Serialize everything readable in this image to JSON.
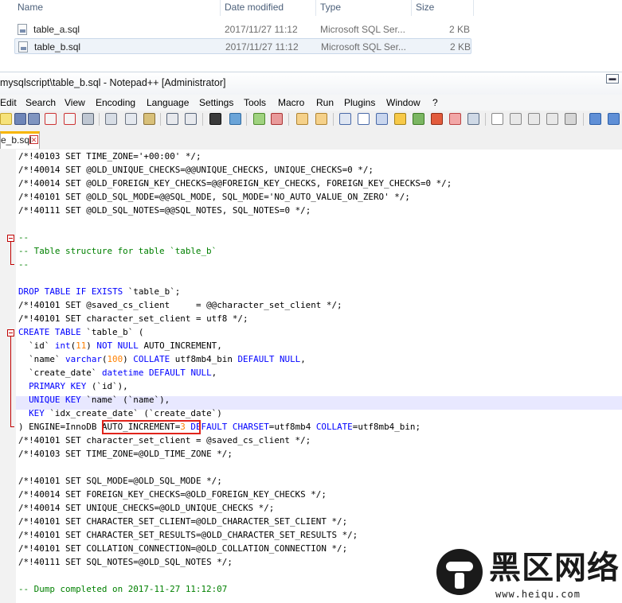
{
  "explorer": {
    "columns": {
      "name": "Name",
      "date": "Date modified",
      "type": "Type",
      "size": "Size"
    },
    "files": [
      {
        "name": "table_a.sql",
        "date": "2017/11/27 11:12",
        "type": "Microsoft SQL Ser...",
        "size": "2 KB"
      },
      {
        "name": "table_b.sql",
        "date": "2017/11/27 11:12",
        "type": "Microsoft SQL Ser...",
        "size": "2 KB"
      }
    ]
  },
  "window": {
    "title": "mysqlscript\\table_b.sql - Notepad++ [Administrator]",
    "menu": [
      "Edit",
      "Search",
      "View",
      "Encoding",
      "Language",
      "Settings",
      "Tools",
      "Macro",
      "Run",
      "Plugins",
      "Window",
      "?"
    ],
    "tab_label": "e_b.sql"
  },
  "code_lines": [
    "/*!40103 SET TIME_ZONE='+00:00' */;",
    "/*!40014 SET @OLD_UNIQUE_CHECKS=@@UNIQUE_CHECKS, UNIQUE_CHECKS=0 */;",
    "/*!40014 SET @OLD_FOREIGN_KEY_CHECKS=@@FOREIGN_KEY_CHECKS, FOREIGN_KEY_CHECKS=0 */;",
    "/*!40101 SET @OLD_SQL_MODE=@@SQL_MODE, SQL_MODE='NO_AUTO_VALUE_ON_ZERO' */;",
    "/*!40111 SET @OLD_SQL_NOTES=@@SQL_NOTES, SQL_NOTES=0 */;",
    "",
    "--",
    "-- Table structure for table `table_b`",
    "--",
    "",
    "DROP TABLE IF EXISTS `table_b`;",
    "/*!40101 SET @saved_cs_client     = @@character_set_client */;",
    "/*!40101 SET character_set_client = utf8 */;",
    "CREATE TABLE `table_b` (",
    "  `id` int(11) NOT NULL AUTO_INCREMENT,",
    "  `name` varchar(100) COLLATE utf8mb4_bin DEFAULT NULL,",
    "  `create_date` datetime DEFAULT NULL,",
    "  PRIMARY KEY (`id`),",
    "  UNIQUE KEY `name` (`name`),",
    "  KEY `idx_create_date` (`create_date`)",
    ") ENGINE=InnoDB AUTO_INCREMENT=3 DEFAULT CHARSET=utf8mb4 COLLATE=utf8mb4_bin;",
    "/*!40101 SET character_set_client = @saved_cs_client */;",
    "/*!40103 SET TIME_ZONE=@OLD_TIME_ZONE */;",
    "",
    "/*!40101 SET SQL_MODE=@OLD_SQL_MODE */;",
    "/*!40014 SET FOREIGN_KEY_CHECKS=@OLD_FOREIGN_KEY_CHECKS */;",
    "/*!40014 SET UNIQUE_CHECKS=@OLD_UNIQUE_CHECKS */;",
    "/*!40101 SET CHARACTER_SET_CLIENT=@OLD_CHARACTER_SET_CLIENT */;",
    "/*!40101 SET CHARACTER_SET_RESULTS=@OLD_CHARACTER_SET_RESULTS */;",
    "/*!40101 SET COLLATION_CONNECTION=@OLD_COLLATION_CONNECTION */;",
    "/*!40111 SET SQL_NOTES=@OLD_SQL_NOTES */;",
    "",
    "-- Dump completed on 2017-11-27 11:12:07"
  ],
  "highlighted_line": 18,
  "watermark": {
    "chinese": "黑区网络",
    "url": "www.heiqu.com"
  },
  "colors": {
    "keyword": "#0000ff",
    "comment": "#008000",
    "number": "#ff8000",
    "highlight": "#e8e8ff",
    "annotation_box": "#e0241b"
  }
}
